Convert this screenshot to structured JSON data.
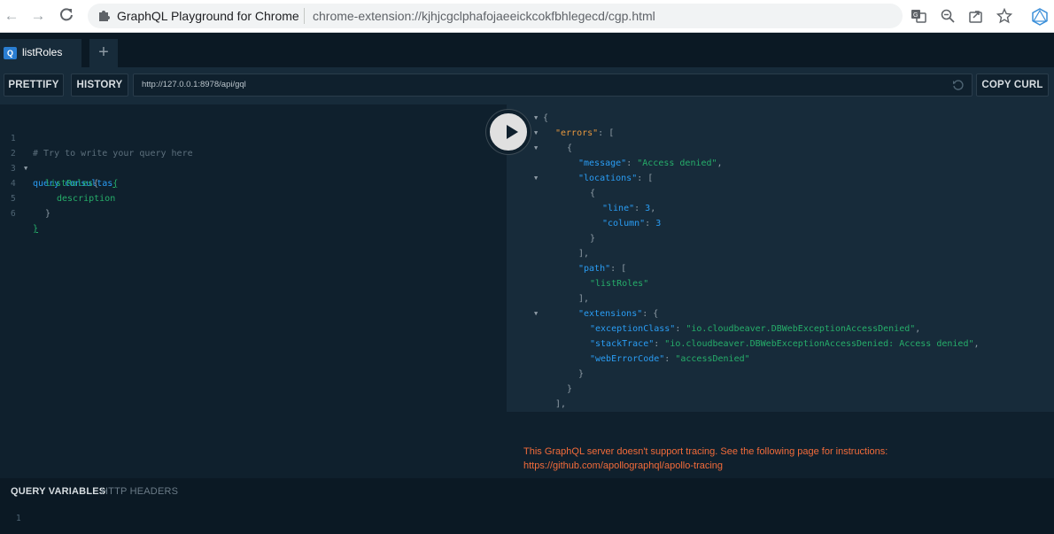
{
  "browser": {
    "site_name": "GraphQL Playground for Chrome",
    "url": "chrome-extension://kjhjcgclphafojaeeickcokfbhlegecd/cgp.html"
  },
  "tabs": [
    {
      "badge": "Q",
      "label": "listRoles",
      "close": "×"
    }
  ],
  "add_tab_label": "+",
  "toolbar": {
    "prettify_label": "PRETTIFY",
    "history_label": "HISTORY",
    "endpoint": "http://127.0.0.1:8978/api/gql",
    "copy_curl_label": "COPY CURL"
  },
  "editor": {
    "line_numbers": [
      "1",
      "2",
      "3",
      "4",
      "5",
      "6"
    ],
    "comment": "# Try to write your query here",
    "keyword": "query",
    "operation_name": "consultas",
    "open_brace": "{",
    "field": "listRoles",
    "field_open": "{",
    "subfield": "description",
    "inner_close": "}",
    "outer_close": "}"
  },
  "result": {
    "lines": [
      "{",
      "\"errors\": [",
      "{",
      "\"message\": \"Access denied\",",
      "\"locations\": [",
      "{",
      "\"line\": 3,",
      "\"column\": 3",
      "}",
      "],",
      "\"path\": [",
      "\"listRoles\"",
      "],",
      "\"extensions\": {",
      "\"exceptionClass\": \"io.cloudbeaver.DBWebExceptionAccessDenied\",",
      "\"stackTrace\": \"io.cloudbeaver.DBWebExceptionAccessDenied: Access denied\",",
      "\"webErrorCode\": \"accessDenied\"",
      "}",
      "}",
      "],"
    ]
  },
  "tracing": {
    "message": "This GraphQL server doesn't support tracing. See the following page for instructions:",
    "link": "https://github.com/apollographql/apollo-tracing"
  },
  "variables": {
    "query_variables_label": "QUERY VARIABLES",
    "http_headers_label": "HTTP HEADERS",
    "line_number": "1"
  },
  "colors": {
    "background": "#0f202d",
    "panel": "#172b3a",
    "string": "#26ae6a",
    "keyword": "#2a9df4",
    "error_key": "#e8983e",
    "tracing_text": "#f26b3a"
  }
}
